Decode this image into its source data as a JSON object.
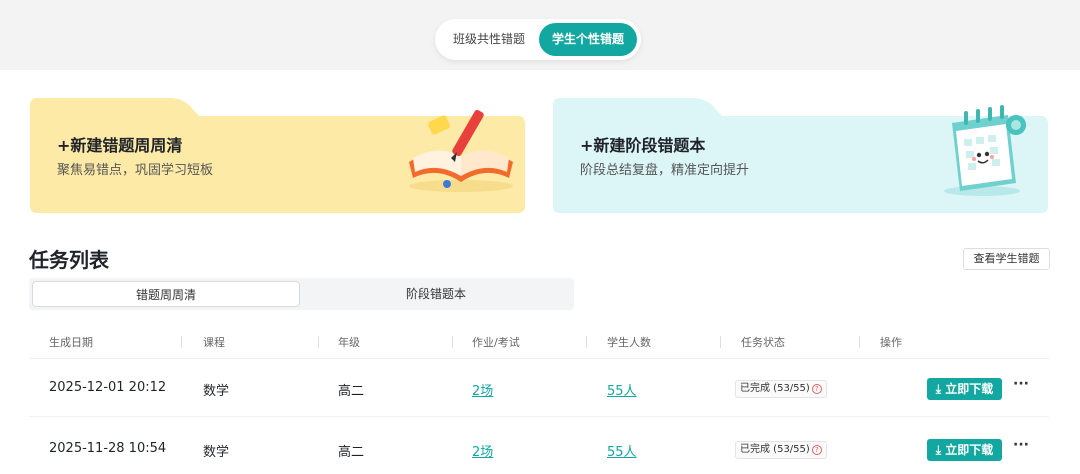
{
  "header": {
    "tabs": [
      {
        "label": "班级共性错题",
        "active": false
      },
      {
        "label": "学生个性错题",
        "active": true
      }
    ]
  },
  "cards": [
    {
      "title": "+新建错题周周清",
      "subtitle": "聚焦易错点，巩固学习短板",
      "color": "#fdeaa6",
      "icon": "book-pencil-icon"
    },
    {
      "title": "+新建阶段错题本",
      "subtitle": "阶段总结复盘，精准定向提升",
      "color": "#dcf5f6",
      "icon": "calendar-icon"
    }
  ],
  "tasks": {
    "title": "任务列表",
    "view_students_label": "查看学生错题",
    "subtabs": [
      {
        "label": "错题周周清",
        "active": true
      },
      {
        "label": "阶段错题本",
        "active": false
      }
    ],
    "columns": [
      "生成日期",
      "课程",
      "年级",
      "作业/考试",
      "学生人数",
      "任务状态",
      "操作"
    ],
    "rows": [
      {
        "date": "2025-12-01 20:12",
        "course": "数学",
        "grade": "高二",
        "exams": "2场",
        "students": "55人",
        "status": "已完成 (53/55)",
        "download": "立即下载",
        "more": "···"
      },
      {
        "date": "2025-11-28 10:54",
        "course": "数学",
        "grade": "高二",
        "exams": "2场",
        "students": "55人",
        "status": "已完成 (53/55)",
        "download": "立即下载",
        "more": "···"
      }
    ]
  },
  "colors": {
    "accent": "#13a7a1",
    "warning": "#e06060"
  }
}
